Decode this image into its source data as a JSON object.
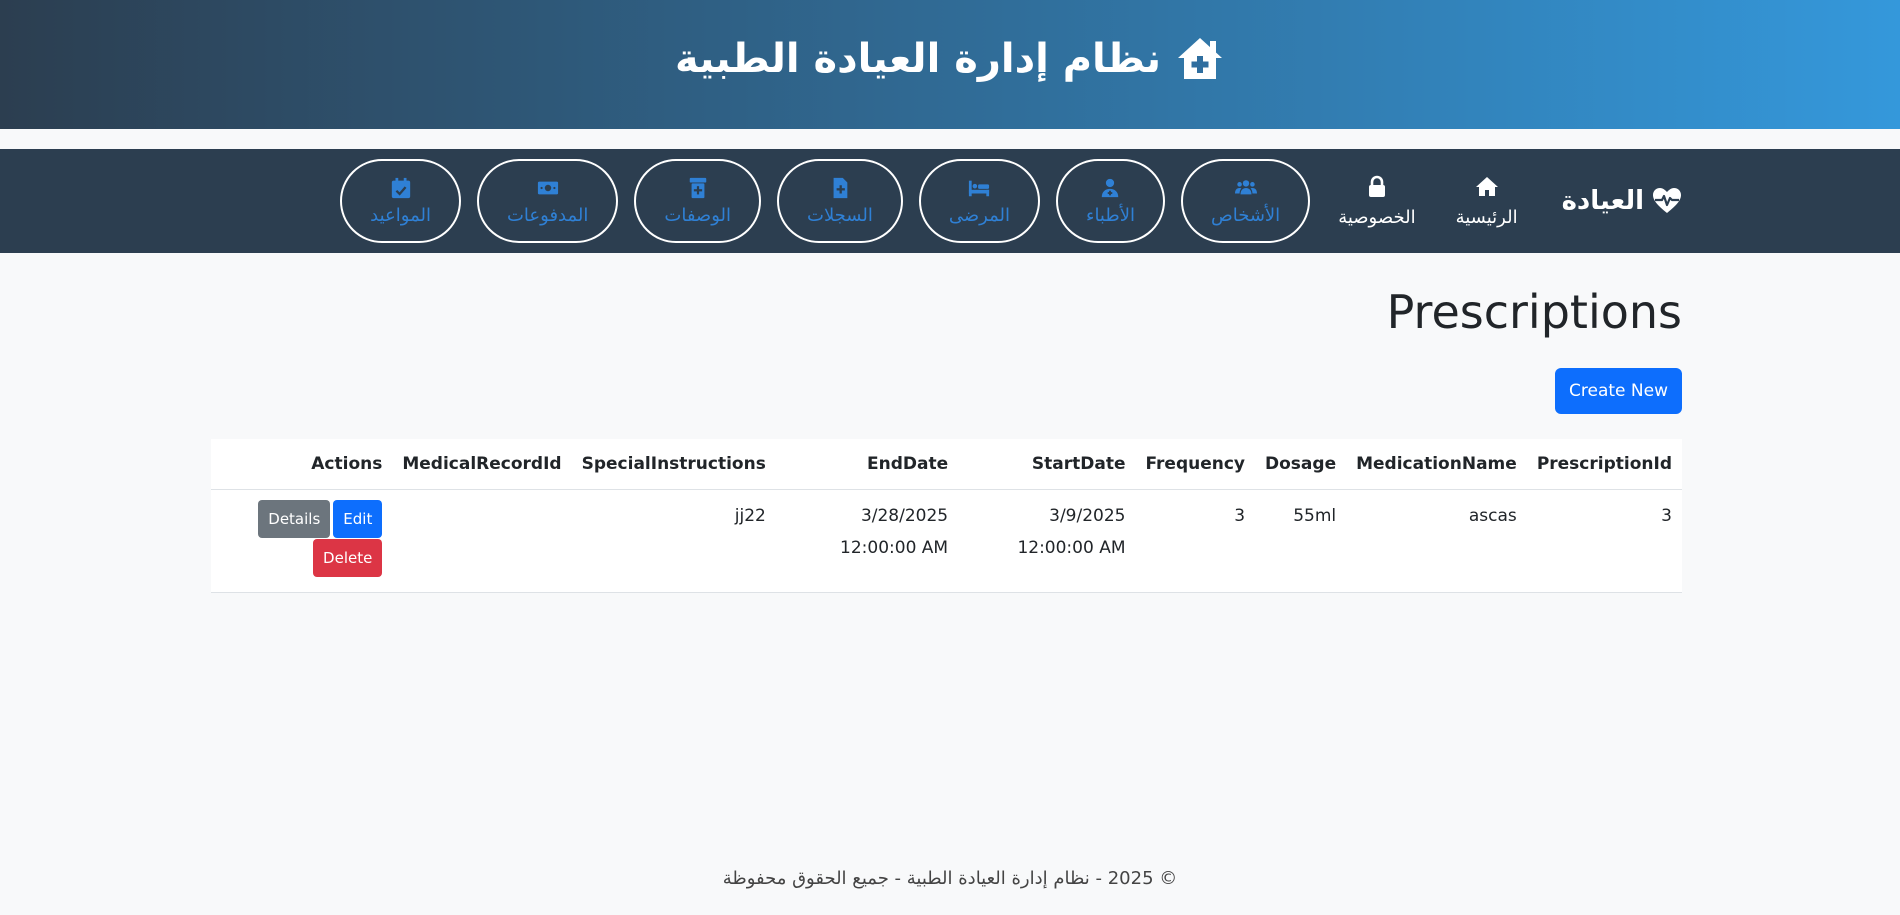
{
  "header": {
    "title": "نظام إدارة العيادة الطبية",
    "icon": "house-medical-icon"
  },
  "nav": {
    "brand": {
      "label": "العيادة",
      "icon": "heart-pulse-icon"
    },
    "plain_items": [
      {
        "label": "الرئيسية",
        "icon": "home-icon"
      },
      {
        "label": "الخصوصية",
        "icon": "lock-icon"
      }
    ],
    "pill_items": [
      {
        "label": "الأشخاص",
        "icon": "users-icon"
      },
      {
        "label": "الأطباء",
        "icon": "doctor-icon"
      },
      {
        "label": "المرضى",
        "icon": "bed-icon"
      },
      {
        "label": "السجلات",
        "icon": "medical-file-icon"
      },
      {
        "label": "الوصفات",
        "icon": "prescription-bottle-icon"
      },
      {
        "label": "المدفوعات",
        "icon": "money-icon"
      },
      {
        "label": "المواعيد",
        "icon": "calendar-check-icon"
      }
    ]
  },
  "main": {
    "title": "Prescriptions",
    "create_label": "Create New",
    "table": {
      "columns": [
        "PrescriptionId",
        "MedicationName",
        "Dosage",
        "Frequency",
        "StartDate",
        "EndDate",
        "SpecialInstructions",
        "MedicalRecordId",
        "Actions"
      ],
      "rows": [
        {
          "PrescriptionId": "3",
          "MedicationName": "ascas",
          "Dosage": "55ml",
          "Frequency": "3",
          "StartDate": "3/9/2025 12:00:00 AM",
          "EndDate": "3/28/2025 12:00:00 AM",
          "SpecialInstructions": "jj22",
          "MedicalRecordId": ""
        }
      ],
      "actions": {
        "details": "Details",
        "edit": "Edit",
        "delete": "Delete"
      }
    }
  },
  "footer": {
    "text": "© 2025 - نظام إدارة العيادة الطبية - جميع الحقوق محفوظة"
  },
  "colors": {
    "header_gradient_start": "#2c3e50",
    "header_gradient_end": "#3498db",
    "navbar_bg": "#2c3e50",
    "pill_text": "#2f80d5",
    "primary": "#0d6efd",
    "secondary": "#6c757d",
    "danger": "#dc3545"
  }
}
